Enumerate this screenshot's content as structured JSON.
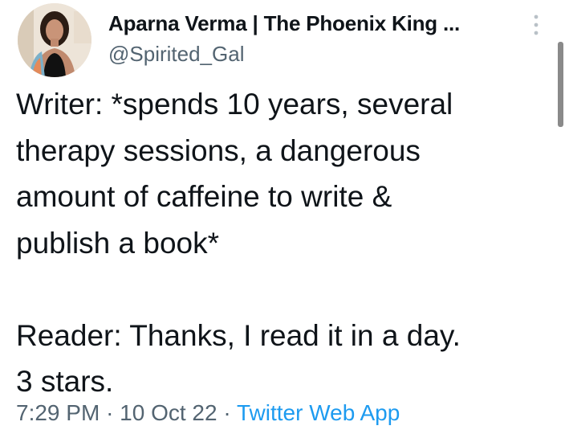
{
  "author": {
    "display_name": "Aparna Verma | The Phoenix King ...",
    "handle": "@Spirited_Gal",
    "avatar_icon": "profile-photo"
  },
  "tweet": {
    "text": "Writer: *spends 10 years, several\ntherapy sessions, a dangerous\namount of caffeine to write &\npublish a book*\n\nReader: Thanks, I read it in a day.\n3 stars."
  },
  "meta": {
    "time": "7:29 PM",
    "separator": "·",
    "date": "10 Oct 22",
    "source": "Twitter Web App"
  },
  "icons": {
    "more": "more-vertical-icon"
  },
  "colors": {
    "text_primary": "#0f1419",
    "text_secondary": "#536471",
    "link": "#1d9bf0"
  }
}
